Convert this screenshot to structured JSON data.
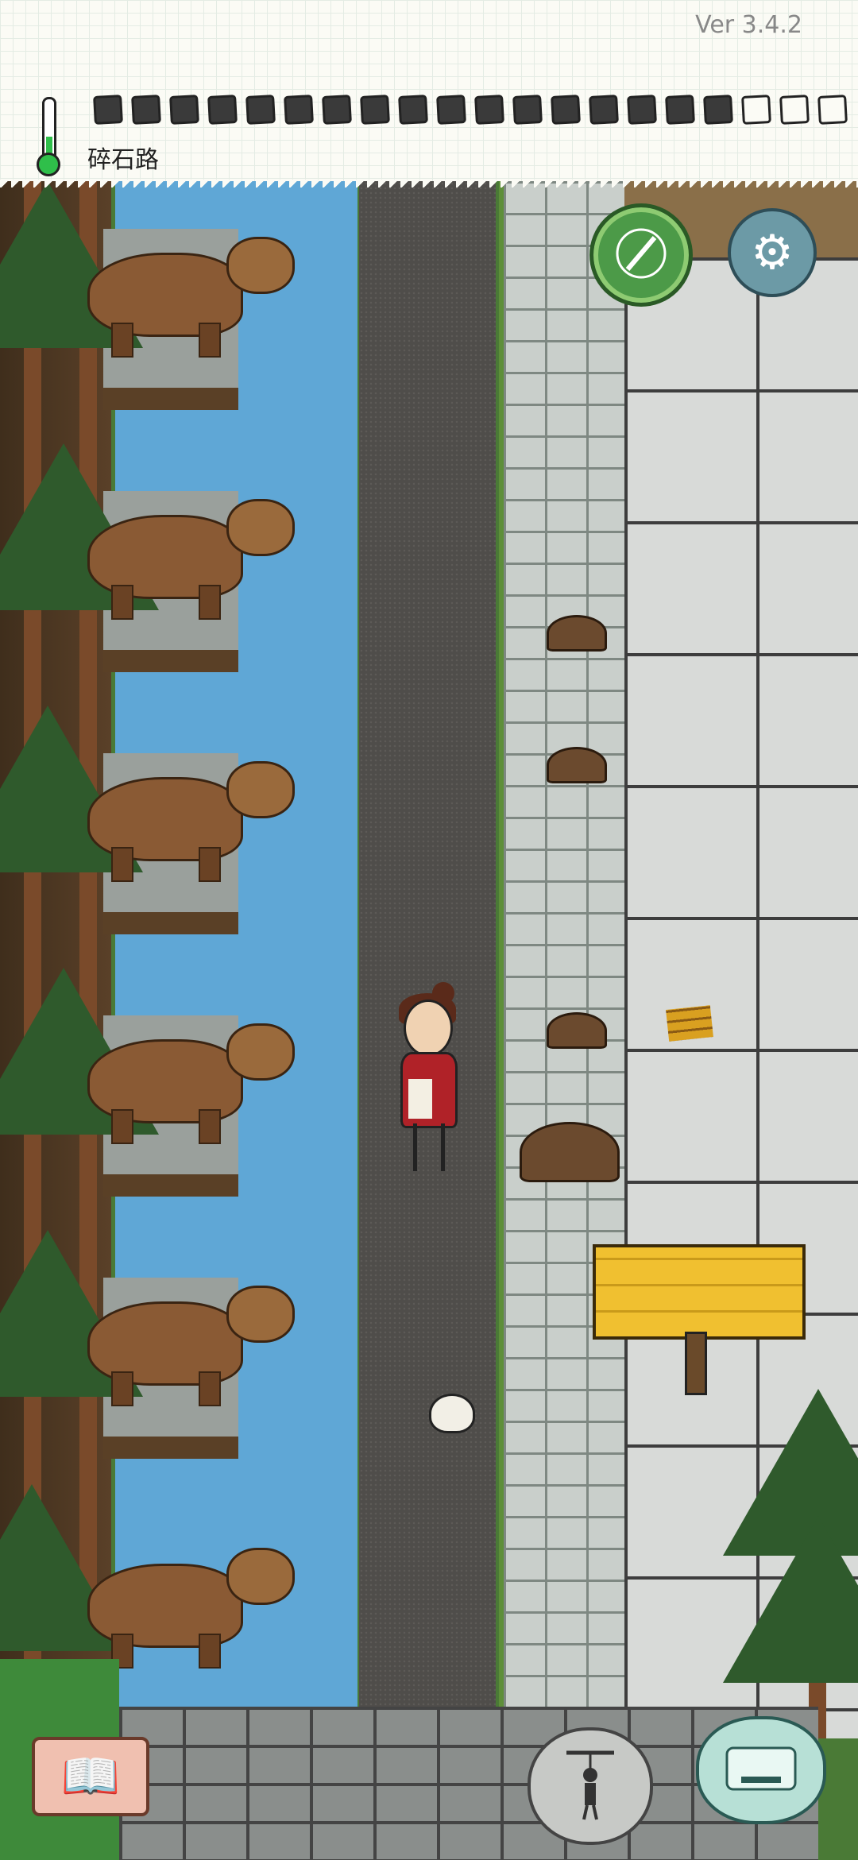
{
  "app": {
    "version": "Ver 3.4.2",
    "location": "碎石路"
  },
  "status": {
    "temperature_icon": "thermometer-icon",
    "hunger_filled": 17,
    "hunger_total": 20
  },
  "icons": {
    "craft": "compass-quill-icon",
    "settings": "gear-icon",
    "journal": "open-book-icon",
    "puppet": "puppet-icon",
    "keyboard": "keyboard-icon"
  },
  "colors": {
    "thermometer_fill": "#2fbf4a",
    "craft_button": "#4c9a48",
    "settings_button": "#6c9aa6",
    "sign": "#f0c030",
    "river": "#5fa7d6"
  }
}
